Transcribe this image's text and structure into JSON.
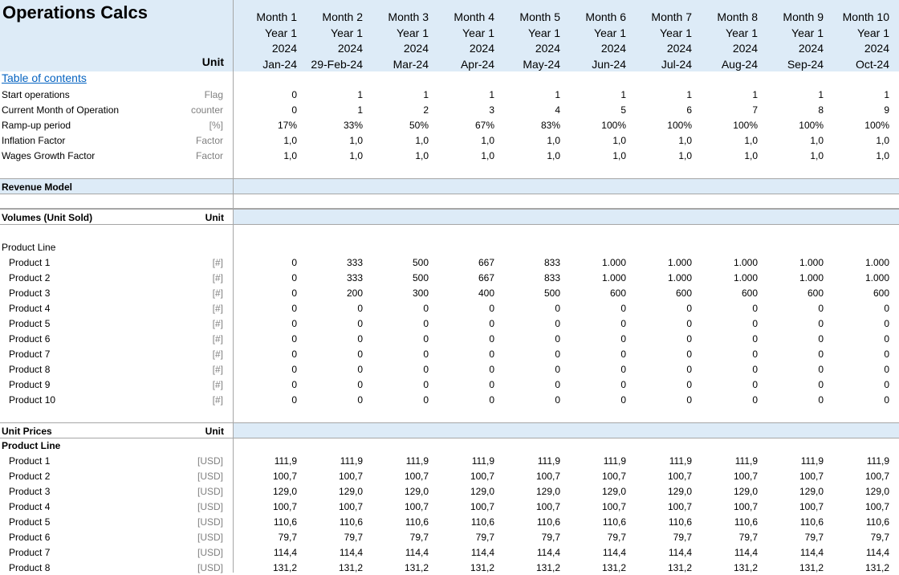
{
  "title": "Operations Calcs",
  "unit_header": "Unit",
  "columns": [
    {
      "month": "Month 1",
      "year": "Year 1",
      "cal_year": "2024",
      "date": "Jan-24"
    },
    {
      "month": "Month 2",
      "year": "Year 1",
      "cal_year": "2024",
      "date": "29-Feb-24"
    },
    {
      "month": "Month 3",
      "year": "Year 1",
      "cal_year": "2024",
      "date": "Mar-24"
    },
    {
      "month": "Month 4",
      "year": "Year 1",
      "cal_year": "2024",
      "date": "Apr-24"
    },
    {
      "month": "Month 5",
      "year": "Year 1",
      "cal_year": "2024",
      "date": "May-24"
    },
    {
      "month": "Month 6",
      "year": "Year 1",
      "cal_year": "2024",
      "date": "Jun-24"
    },
    {
      "month": "Month 7",
      "year": "Year 1",
      "cal_year": "2024",
      "date": "Jul-24"
    },
    {
      "month": "Month 8",
      "year": "Year 1",
      "cal_year": "2024",
      "date": "Aug-24"
    },
    {
      "month": "Month 9",
      "year": "Year 1",
      "cal_year": "2024",
      "date": "Sep-24"
    },
    {
      "month": "Month 10",
      "year": "Year 1",
      "cal_year": "2024",
      "date": "Oct-24"
    }
  ],
  "toc_link": "Table of contents",
  "general_rows": [
    {
      "label": "Start operations",
      "unit": "Flag",
      "values": [
        "0",
        "1",
        "1",
        "1",
        "1",
        "1",
        "1",
        "1",
        "1",
        "1"
      ]
    },
    {
      "label": "Current Month of Operation",
      "unit": "counter",
      "values": [
        "0",
        "1",
        "2",
        "3",
        "4",
        "5",
        "6",
        "7",
        "8",
        "9"
      ]
    },
    {
      "label": "Ramp-up period",
      "unit": "[%]",
      "values": [
        "17%",
        "33%",
        "50%",
        "67%",
        "83%",
        "100%",
        "100%",
        "100%",
        "100%",
        "100%"
      ]
    },
    {
      "label": "Inflation Factor",
      "unit": "Factor",
      "values": [
        "1,0",
        "1,0",
        "1,0",
        "1,0",
        "1,0",
        "1,0",
        "1,0",
        "1,0",
        "1,0",
        "1,0"
      ]
    },
    {
      "label": "Wages Growth Factor",
      "unit": "Factor",
      "values": [
        "1,0",
        "1,0",
        "1,0",
        "1,0",
        "1,0",
        "1,0",
        "1,0",
        "1,0",
        "1,0",
        "1,0"
      ]
    }
  ],
  "revenue_section": {
    "label": "Revenue Model"
  },
  "volumes_section": {
    "label": "Volumes (Unit Sold)",
    "unit": "Unit",
    "group_label": "Product Line"
  },
  "volume_rows": [
    {
      "label": "Product 1",
      "unit": "[#]",
      "values": [
        "0",
        "333",
        "500",
        "667",
        "833",
        "1.000",
        "1.000",
        "1.000",
        "1.000",
        "1.000"
      ]
    },
    {
      "label": "Product 2",
      "unit": "[#]",
      "values": [
        "0",
        "333",
        "500",
        "667",
        "833",
        "1.000",
        "1.000",
        "1.000",
        "1.000",
        "1.000"
      ]
    },
    {
      "label": "Product 3",
      "unit": "[#]",
      "values": [
        "0",
        "200",
        "300",
        "400",
        "500",
        "600",
        "600",
        "600",
        "600",
        "600"
      ]
    },
    {
      "label": "Product 4",
      "unit": "[#]",
      "values": [
        "0",
        "0",
        "0",
        "0",
        "0",
        "0",
        "0",
        "0",
        "0",
        "0"
      ]
    },
    {
      "label": "Product 5",
      "unit": "[#]",
      "values": [
        "0",
        "0",
        "0",
        "0",
        "0",
        "0",
        "0",
        "0",
        "0",
        "0"
      ]
    },
    {
      "label": "Product 6",
      "unit": "[#]",
      "values": [
        "0",
        "0",
        "0",
        "0",
        "0",
        "0",
        "0",
        "0",
        "0",
        "0"
      ]
    },
    {
      "label": "Product 7",
      "unit": "[#]",
      "values": [
        "0",
        "0",
        "0",
        "0",
        "0",
        "0",
        "0",
        "0",
        "0",
        "0"
      ]
    },
    {
      "label": "Product 8",
      "unit": "[#]",
      "values": [
        "0",
        "0",
        "0",
        "0",
        "0",
        "0",
        "0",
        "0",
        "0",
        "0"
      ]
    },
    {
      "label": "Product 9",
      "unit": "[#]",
      "values": [
        "0",
        "0",
        "0",
        "0",
        "0",
        "0",
        "0",
        "0",
        "0",
        "0"
      ]
    },
    {
      "label": "Product 10",
      "unit": "[#]",
      "values": [
        "0",
        "0",
        "0",
        "0",
        "0",
        "0",
        "0",
        "0",
        "0",
        "0"
      ]
    }
  ],
  "prices_section": {
    "label": "Unit Prices",
    "unit": "Unit",
    "group_label": "Product Line"
  },
  "price_rows": [
    {
      "label": "Product 1",
      "unit": "[USD]",
      "values": [
        "111,9",
        "111,9",
        "111,9",
        "111,9",
        "111,9",
        "111,9",
        "111,9",
        "111,9",
        "111,9",
        "111,9"
      ]
    },
    {
      "label": "Product 2",
      "unit": "[USD]",
      "values": [
        "100,7",
        "100,7",
        "100,7",
        "100,7",
        "100,7",
        "100,7",
        "100,7",
        "100,7",
        "100,7",
        "100,7"
      ]
    },
    {
      "label": "Product 3",
      "unit": "[USD]",
      "values": [
        "129,0",
        "129,0",
        "129,0",
        "129,0",
        "129,0",
        "129,0",
        "129,0",
        "129,0",
        "129,0",
        "129,0"
      ]
    },
    {
      "label": "Product 4",
      "unit": "[USD]",
      "values": [
        "100,7",
        "100,7",
        "100,7",
        "100,7",
        "100,7",
        "100,7",
        "100,7",
        "100,7",
        "100,7",
        "100,7"
      ]
    },
    {
      "label": "Product 5",
      "unit": "[USD]",
      "values": [
        "110,6",
        "110,6",
        "110,6",
        "110,6",
        "110,6",
        "110,6",
        "110,6",
        "110,6",
        "110,6",
        "110,6"
      ]
    },
    {
      "label": "Product 6",
      "unit": "[USD]",
      "values": [
        "79,7",
        "79,7",
        "79,7",
        "79,7",
        "79,7",
        "79,7",
        "79,7",
        "79,7",
        "79,7",
        "79,7"
      ]
    },
    {
      "label": "Product 7",
      "unit": "[USD]",
      "values": [
        "114,4",
        "114,4",
        "114,4",
        "114,4",
        "114,4",
        "114,4",
        "114,4",
        "114,4",
        "114,4",
        "114,4"
      ]
    },
    {
      "label": "Product 8",
      "unit": "[USD]",
      "values": [
        "131,2",
        "131,2",
        "131,2",
        "131,2",
        "131,2",
        "131,2",
        "131,2",
        "131,2",
        "131,2",
        "131,2"
      ]
    }
  ]
}
